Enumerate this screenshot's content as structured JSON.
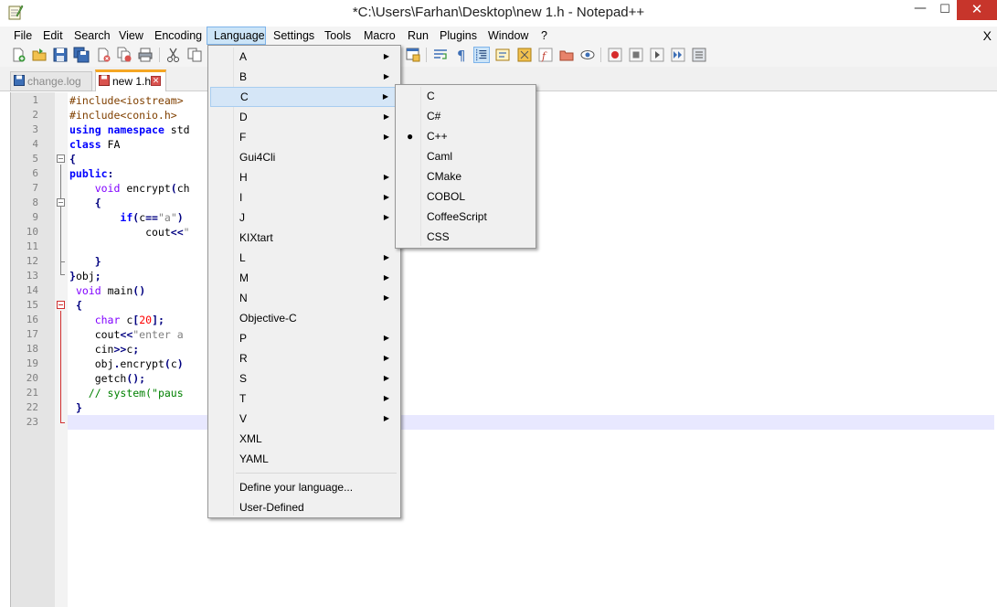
{
  "window": {
    "title": "*C:\\Users\\Farhan\\Desktop\\new 1.h - Notepad++",
    "minimize_glyph": "—",
    "maximize_glyph": "☐",
    "close_glyph": "✕"
  },
  "menubar": {
    "items": [
      "File",
      "Edit",
      "Search",
      "View",
      "Encoding",
      "Language",
      "Settings",
      "Tools",
      "Macro",
      "Run",
      "Plugins",
      "Window",
      "?"
    ],
    "active": "Language",
    "close_label": "X"
  },
  "tabs": [
    {
      "label": "change.log",
      "active": false
    },
    {
      "label": "new 1.h",
      "active": true,
      "close_glyph": "✕"
    }
  ],
  "editor": {
    "line_numbers": [
      "1",
      "2",
      "3",
      "4",
      "5",
      "6",
      "7",
      "8",
      "9",
      "10",
      "11",
      "12",
      "13",
      "14",
      "15",
      "16",
      "17",
      "18",
      "19",
      "20",
      "21",
      "22",
      "23"
    ],
    "current_line": 23,
    "lines": [
      [
        {
          "t": "#include<iostream>",
          "c": "pre"
        }
      ],
      [
        {
          "t": "#include<conio.h>",
          "c": "pre"
        }
      ],
      [
        {
          "t": "using",
          "c": "kw"
        },
        {
          "t": " "
        },
        {
          "t": "namespace",
          "c": "kw"
        },
        {
          "t": " std"
        }
      ],
      [
        {
          "t": "class",
          "c": "kw"
        },
        {
          "t": " FA"
        }
      ],
      [
        {
          "t": "{",
          "c": "op"
        }
      ],
      [
        {
          "t": "public",
          "c": "kw"
        },
        {
          "t": ":",
          "c": "op"
        }
      ],
      [
        {
          "t": "    "
        },
        {
          "t": "void",
          "c": "typ"
        },
        {
          "t": " encrypt"
        },
        {
          "t": "(",
          "c": "op"
        },
        {
          "t": "ch"
        }
      ],
      [
        {
          "t": "    "
        },
        {
          "t": "{",
          "c": "op"
        }
      ],
      [
        {
          "t": "        "
        },
        {
          "t": "if",
          "c": "kw"
        },
        {
          "t": "(",
          "c": "op"
        },
        {
          "t": "c"
        },
        {
          "t": "==",
          "c": "op"
        },
        {
          "t": "\"a\"",
          "c": "str"
        },
        {
          "t": ")",
          "c": "op"
        }
      ],
      [
        {
          "t": "            cout"
        },
        {
          "t": "<<",
          "c": "op"
        },
        {
          "t": "\"",
          "c": "str"
        }
      ],
      [
        {
          "t": ""
        }
      ],
      [
        {
          "t": "    "
        },
        {
          "t": "}",
          "c": "op"
        }
      ],
      [
        {
          "t": "}",
          "c": "op"
        },
        {
          "t": "obj"
        },
        {
          "t": ";",
          "c": "op"
        }
      ],
      [
        {
          "t": " "
        },
        {
          "t": "void",
          "c": "typ"
        },
        {
          "t": " main"
        },
        {
          "t": "()",
          "c": "op"
        }
      ],
      [
        {
          "t": " "
        },
        {
          "t": "{",
          "c": "op"
        }
      ],
      [
        {
          "t": "    "
        },
        {
          "t": "char",
          "c": "typ"
        },
        {
          "t": " c"
        },
        {
          "t": "[",
          "c": "op"
        },
        {
          "t": "20",
          "c": "num"
        },
        {
          "t": "];",
          "c": "op"
        }
      ],
      [
        {
          "t": "    cout"
        },
        {
          "t": "<<",
          "c": "op"
        },
        {
          "t": "\"enter a",
          "c": "str"
        }
      ],
      [
        {
          "t": "    cin"
        },
        {
          "t": ">>",
          "c": "op"
        },
        {
          "t": "c"
        },
        {
          "t": ";",
          "c": "op"
        }
      ],
      [
        {
          "t": "    obj"
        },
        {
          "t": ".",
          "c": "op"
        },
        {
          "t": "encrypt"
        },
        {
          "t": "(",
          "c": "op"
        },
        {
          "t": "c"
        },
        {
          "t": ")",
          "c": "op"
        }
      ],
      [
        {
          "t": "    getch"
        },
        {
          "t": "();",
          "c": "op"
        }
      ],
      [
        {
          "t": "   "
        },
        {
          "t": "// system(\"paus",
          "c": "cmt"
        }
      ],
      [
        {
          "t": " "
        },
        {
          "t": "}",
          "c": "op"
        }
      ],
      [
        {
          "t": ""
        }
      ]
    ]
  },
  "language_menu": {
    "items": [
      {
        "label": "A",
        "submenu": true
      },
      {
        "label": "B",
        "submenu": true
      },
      {
        "label": "C",
        "submenu": true,
        "highlighted": true
      },
      {
        "label": "D",
        "submenu": true
      },
      {
        "label": "F",
        "submenu": true
      },
      {
        "label": "Gui4Cli",
        "submenu": false
      },
      {
        "label": "H",
        "submenu": true
      },
      {
        "label": "I",
        "submenu": true
      },
      {
        "label": "J",
        "submenu": true
      },
      {
        "label": "KIXtart",
        "submenu": false
      },
      {
        "label": "L",
        "submenu": true
      },
      {
        "label": "M",
        "submenu": true
      },
      {
        "label": "N",
        "submenu": true
      },
      {
        "label": "Objective-C",
        "submenu": false
      },
      {
        "label": "P",
        "submenu": true
      },
      {
        "label": "R",
        "submenu": true
      },
      {
        "label": "S",
        "submenu": true
      },
      {
        "label": "T",
        "submenu": true
      },
      {
        "label": "V",
        "submenu": true
      },
      {
        "label": "XML",
        "submenu": false
      },
      {
        "label": "YAML",
        "submenu": false
      }
    ],
    "footer_items": [
      "Define your language...",
      "User-Defined"
    ],
    "submenu_glyph": "▶"
  },
  "c_submenu": {
    "items": [
      "C",
      "C#",
      "C++",
      "Caml",
      "CMake",
      "COBOL",
      "CoffeeScript",
      "CSS"
    ],
    "selected": "C++",
    "bullet_glyph": "●"
  }
}
